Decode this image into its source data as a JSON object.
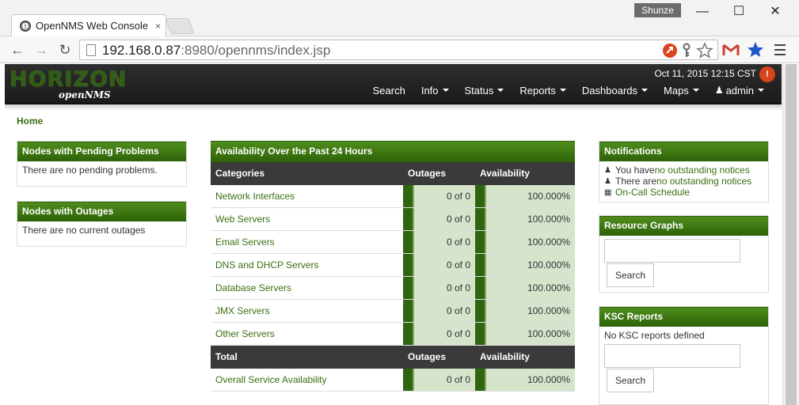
{
  "browser": {
    "tab_title": "OpenNMS Web Console",
    "tab_close": "×",
    "tab_favicon": "ⓘ",
    "user_badge": "Shunze",
    "url_host": "192.168.0.87",
    "url_rest": ":8980/opennms/index.jsp",
    "minimize": "—",
    "maximize": "☐",
    "close": "✕",
    "back": "←",
    "forward": "→",
    "reload": "↻",
    "icons": [
      "back-icon",
      "forward-icon",
      "reload-icon",
      "page-icon",
      "extension-icon",
      "key-icon",
      "bookmark-star-icon",
      "gmail-icon",
      "blue-star-icon",
      "menu-icon"
    ]
  },
  "header": {
    "logo_main": "HORIZON",
    "logo_sub": "openNMS",
    "datetime": "Oct 11, 2015 12:15 CST",
    "menu": [
      {
        "label": "Search",
        "caret": false
      },
      {
        "label": "Info",
        "caret": true
      },
      {
        "label": "Status",
        "caret": true
      },
      {
        "label": "Reports",
        "caret": true
      },
      {
        "label": "Dashboards",
        "caret": true
      },
      {
        "label": "Maps",
        "caret": true
      },
      {
        "label": "admin",
        "caret": true
      }
    ]
  },
  "breadcrumb": "Home",
  "left": {
    "pending_title": "Nodes with Pending Problems",
    "pending_body": "There are no pending problems.",
    "outages_title": "Nodes with Outages",
    "outages_body": "There are no current outages"
  },
  "availability": {
    "title": "Availability Over the Past 24 Hours",
    "headers": {
      "categories": "Categories",
      "outages": "Outages",
      "availability": "Availability"
    },
    "rows": [
      {
        "category": "Network Interfaces",
        "outages": "0 of 0",
        "availability": "100.000%"
      },
      {
        "category": "Web Servers",
        "outages": "0 of 0",
        "availability": "100.000%"
      },
      {
        "category": "Email Servers",
        "outages": "0 of 0",
        "availability": "100.000%"
      },
      {
        "category": "DNS and DHCP Servers",
        "outages": "0 of 0",
        "availability": "100.000%"
      },
      {
        "category": "Database Servers",
        "outages": "0 of 0",
        "availability": "100.000%"
      },
      {
        "category": "JMX Servers",
        "outages": "0 of 0",
        "availability": "100.000%"
      },
      {
        "category": "Other Servers",
        "outages": "0 of 0",
        "availability": "100.000%"
      }
    ],
    "total_headers": {
      "total": "Total",
      "outages": "Outages",
      "availability": "Availability"
    },
    "total_row": {
      "category": "Overall Service Availability",
      "outages": "0 of 0",
      "availability": "100.000%"
    }
  },
  "right": {
    "notifications_title": "Notifications",
    "notice1_pre": "You have ",
    "notice1_link": "no outstanding notices",
    "notice2_pre": "There are ",
    "notice2_link": "no outstanding notices",
    "oncall": "On-Call Schedule",
    "resource_title": "Resource Graphs",
    "resource_button": "Search",
    "ksc_title": "KSC Reports",
    "ksc_body": "No KSC reports defined",
    "ksc_button": "Search"
  },
  "colors": {
    "accent_green": "#2d6208",
    "link_green": "#3a6f12",
    "header_dark": "#1a1a1a",
    "cell_green": "#d6e4cc"
  }
}
